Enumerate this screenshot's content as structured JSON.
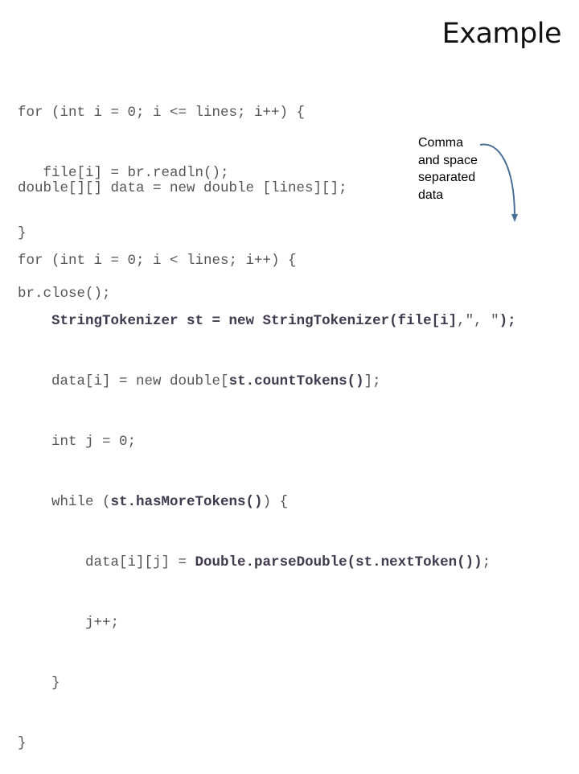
{
  "title": "Example",
  "block1": [
    "for (int i = 0; i <= lines; i++) {",
    "   file[i] = br.readln();",
    "}",
    "br.close();"
  ],
  "decl": "double[][] data = new double [lines][];",
  "note": [
    "Comma",
    "and space",
    "separated",
    "data"
  ],
  "arrow_color": "#4a6f94",
  "block2": {
    "l1": "for (int i = 0; i < lines; i++) {",
    "l2a": "StringTokenizer st = new StringTokenizer(file[i]",
    "l2b": ",\", \"",
    "l2c": ");",
    "l3a": "data[i] = new double[",
    "l3b": "st.countTokens()",
    "l3c": "];",
    "l4": "int j = 0;",
    "l5a": "while (",
    "l5b": "st.hasMoreTokens()",
    "l5c": ") {",
    "l6a": "data[i][j] = ",
    "l6b": "Double.parseDouble(st.nextToken())",
    "l6c": ";",
    "l7": "j++;",
    "l8": "}",
    "l9": "}"
  }
}
